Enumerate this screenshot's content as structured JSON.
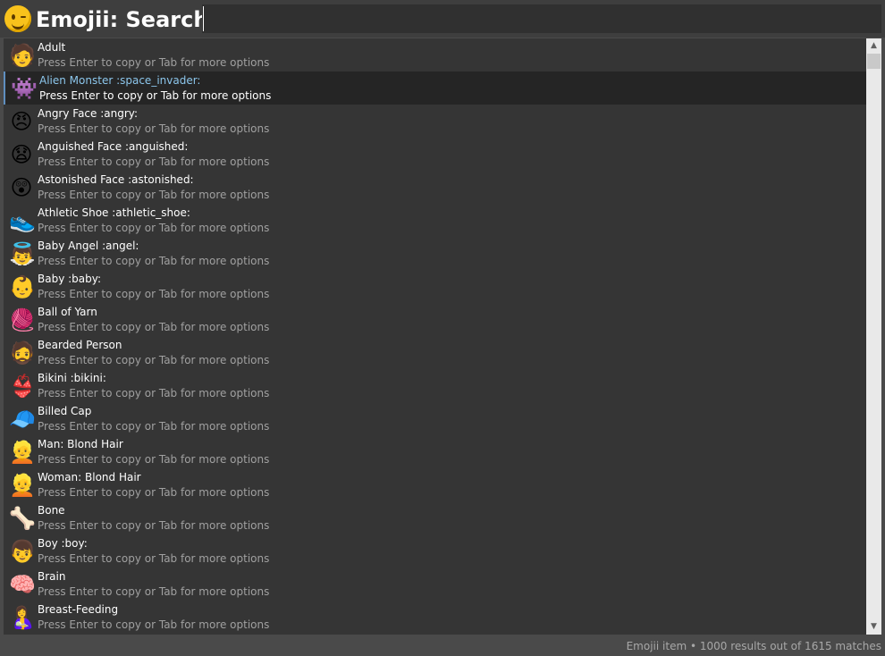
{
  "header": {
    "app_icon": "winking-face-icon",
    "title": "Emojii: Search",
    "search_value": ""
  },
  "colors": {
    "background": "#353535",
    "selected_bg": "#252525",
    "selected_title": "#8cc6ec",
    "hint": "#a0a0a0"
  },
  "items": [
    {
      "emoji": "🧑",
      "title": "Adult",
      "hint": "Press Enter to copy or Tab for more options",
      "selected": false
    },
    {
      "emoji": "👾",
      "title": "Alien Monster :space_invader:",
      "hint": "Press Enter to copy or Tab for more options",
      "selected": true
    },
    {
      "emoji": "😠",
      "title": "Angry Face :angry:",
      "hint": "Press Enter to copy or Tab for more options",
      "selected": false
    },
    {
      "emoji": "😧",
      "title": "Anguished Face :anguished:",
      "hint": "Press Enter to copy or Tab for more options",
      "selected": false
    },
    {
      "emoji": "😲",
      "title": "Astonished Face :astonished:",
      "hint": "Press Enter to copy or Tab for more options",
      "selected": false
    },
    {
      "emoji": "👟",
      "title": "Athletic Shoe :athletic_shoe:",
      "hint": "Press Enter to copy or Tab for more options",
      "selected": false
    },
    {
      "emoji": "👼",
      "title": "Baby Angel :angel:",
      "hint": "Press Enter to copy or Tab for more options",
      "selected": false
    },
    {
      "emoji": "👶",
      "title": "Baby :baby:",
      "hint": "Press Enter to copy or Tab for more options",
      "selected": false
    },
    {
      "emoji": "🧶",
      "title": "Ball of Yarn",
      "hint": "Press Enter to copy or Tab for more options",
      "selected": false
    },
    {
      "emoji": "🧔",
      "title": "Bearded Person",
      "hint": "Press Enter to copy or Tab for more options",
      "selected": false
    },
    {
      "emoji": "👙",
      "title": "Bikini :bikini:",
      "hint": "Press Enter to copy or Tab for more options",
      "selected": false
    },
    {
      "emoji": "🧢",
      "title": "Billed Cap",
      "hint": "Press Enter to copy or Tab for more options",
      "selected": false
    },
    {
      "emoji": "👱",
      "title": "Man: Blond Hair",
      "hint": "Press Enter to copy or Tab for more options",
      "selected": false
    },
    {
      "emoji": "👱",
      "title": "Woman: Blond Hair",
      "hint": "Press Enter to copy or Tab for more options",
      "selected": false
    },
    {
      "emoji": "🦴",
      "title": "Bone",
      "hint": "Press Enter to copy or Tab for more options",
      "selected": false
    },
    {
      "emoji": "👦",
      "title": "Boy :boy:",
      "hint": "Press Enter to copy or Tab for more options",
      "selected": false
    },
    {
      "emoji": "🧠",
      "title": "Brain",
      "hint": "Press Enter to copy or Tab for more options",
      "selected": false
    },
    {
      "emoji": "🤱",
      "title": "Breast-Feeding",
      "hint": "Press Enter to copy or Tab for more options",
      "selected": false
    }
  ],
  "scrollbar": {
    "up_icon": "▲",
    "down_icon": "▼"
  },
  "status": "Emojii item • 1000 results out of 1615 matches"
}
